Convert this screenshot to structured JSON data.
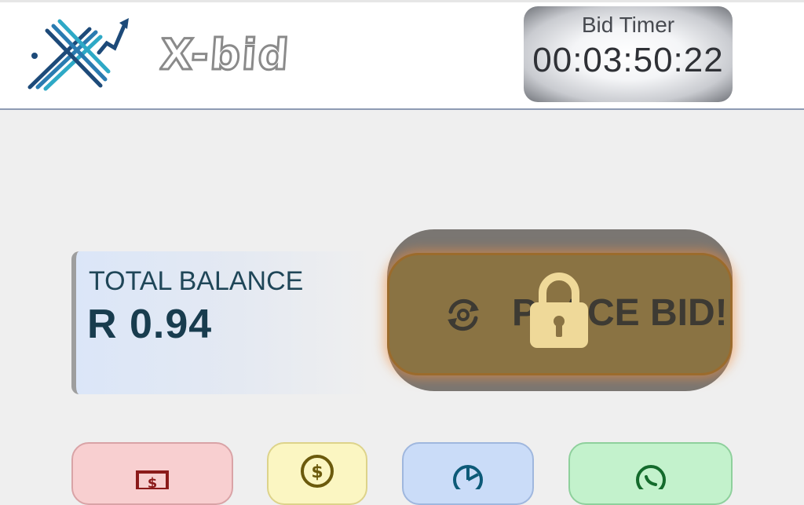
{
  "header": {
    "brand": "X-bid",
    "logo_icon": "x-arrow-logo-icon",
    "timer": {
      "label": "Bid Timer",
      "value": "00:03:50:22"
    }
  },
  "balance": {
    "label": "TOTAL BALANCE",
    "value": "R 0.94"
  },
  "bid_button": {
    "label": "PLACE BID!",
    "icon": "refresh-icon",
    "lock_icon": "padlock-icon",
    "locked": true
  },
  "action_tiles": [
    {
      "icon": "banknote-icon",
      "color": "#f8cfd0"
    },
    {
      "icon": "dollar-coin-icon",
      "color": "#fbf6c2"
    },
    {
      "icon": "chart-icon",
      "color": "#cadcf8"
    },
    {
      "icon": "whatsapp-icon",
      "color": "#c3f2cc"
    }
  ],
  "colors": {
    "accent_text": "#183c4e",
    "bid_button": "#8a7343",
    "lock": "#efd999"
  }
}
